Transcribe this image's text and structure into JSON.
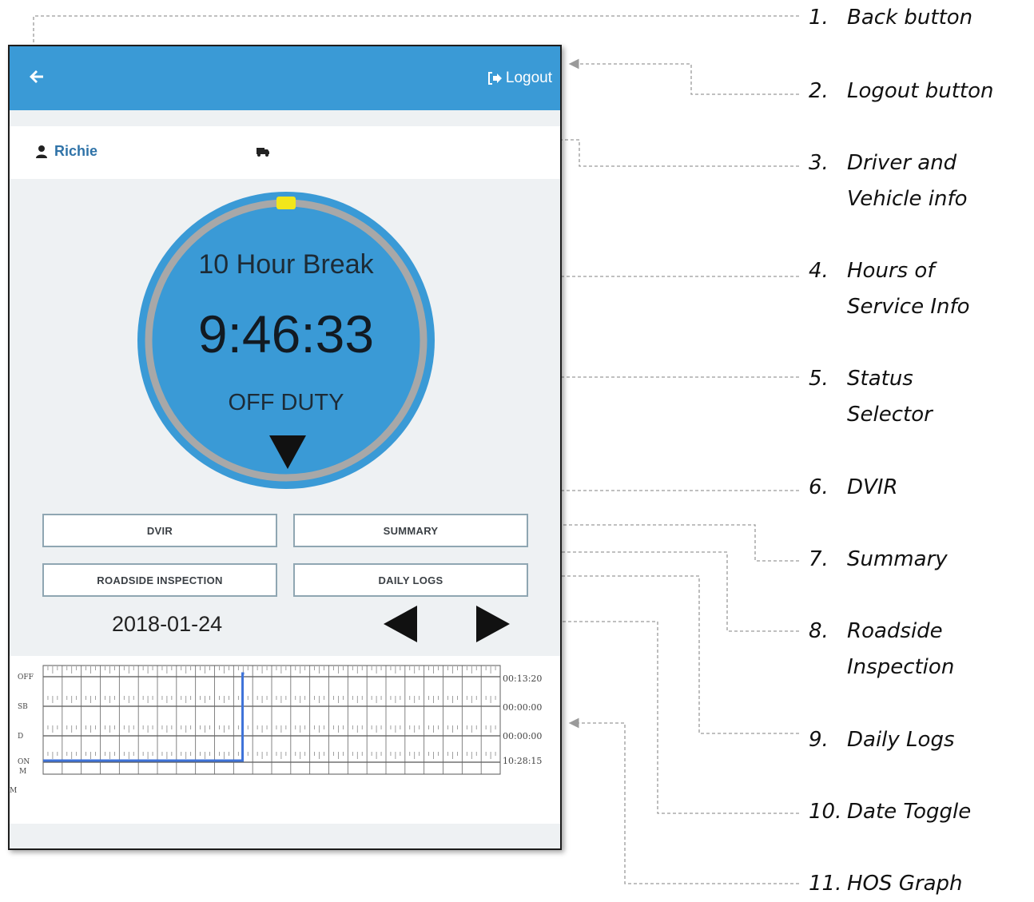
{
  "header": {
    "logout_label": "Logout"
  },
  "info": {
    "driver_name": "Richie"
  },
  "hos": {
    "title": "10 Hour Break",
    "timer": "9:46:33",
    "status": "OFF DUTY",
    "progress_fraction": 0.0
  },
  "actions": {
    "dvir": "DVIR",
    "summary": "SUMMARY",
    "roadside": "ROADSIDE INSPECTION",
    "daily_logs": "DAILY LOGS"
  },
  "date": {
    "value": "2018-01-24"
  },
  "graph": {
    "rows": [
      {
        "label": "OFF",
        "total": "00:13:20"
      },
      {
        "label": "SB",
        "total": "00:00:00"
      },
      {
        "label": "D",
        "total": "00:00:00"
      },
      {
        "label": "ON",
        "total": "10:28:15"
      }
    ],
    "hour_start_label": "M",
    "hour_end_label": "M"
  },
  "annotations": [
    {
      "num": "1.",
      "text": "Back button"
    },
    {
      "num": "2.",
      "text": "Logout button"
    },
    {
      "num": "3.",
      "text": "Driver and Vehicle info"
    },
    {
      "num": "4.",
      "text": "Hours of Service Info"
    },
    {
      "num": "5.",
      "text": "Status Selector"
    },
    {
      "num": "6.",
      "text": "DVIR"
    },
    {
      "num": "7.",
      "text": "Summary"
    },
    {
      "num": "8.",
      "text": "Roadside Inspection"
    },
    {
      "num": "9.",
      "text": "Daily Logs"
    },
    {
      "num": "10.",
      "text": "Date Toggle"
    },
    {
      "num": "11.",
      "text": "HOS Graph"
    }
  ],
  "colors": {
    "appbar": "#3a9ad6",
    "dial_fill": "#3a9ad6",
    "dial_ring": "#a8a8a8",
    "progress_marker": "#f2e61a",
    "graph_line": "#3f73d9"
  },
  "icons": {
    "back": "arrow-left-icon",
    "logout": "logout-icon",
    "driver": "user-icon",
    "vehicle": "truck-icon",
    "status_selector": "triangle-down-icon",
    "date_prev": "triangle-left-icon",
    "date_next": "triangle-right-icon"
  }
}
